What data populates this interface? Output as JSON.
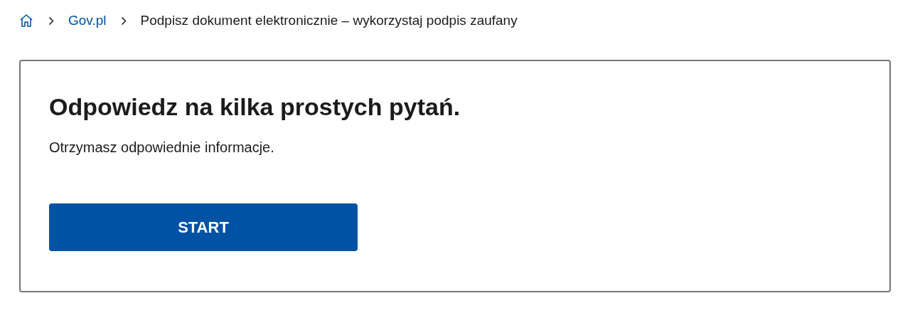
{
  "breadcrumb": [
    {
      "kind": "home"
    },
    {
      "kind": "link",
      "label": "Gov.pl"
    },
    {
      "kind": "current",
      "label": "Podpisz dokument elektronicznie – wykorzystaj podpis zaufany"
    }
  ],
  "card": {
    "heading": "Odpowiedz na kilka prostych pytań.",
    "text": "Otrzymasz odpowiednie informacje.",
    "button": "START"
  }
}
